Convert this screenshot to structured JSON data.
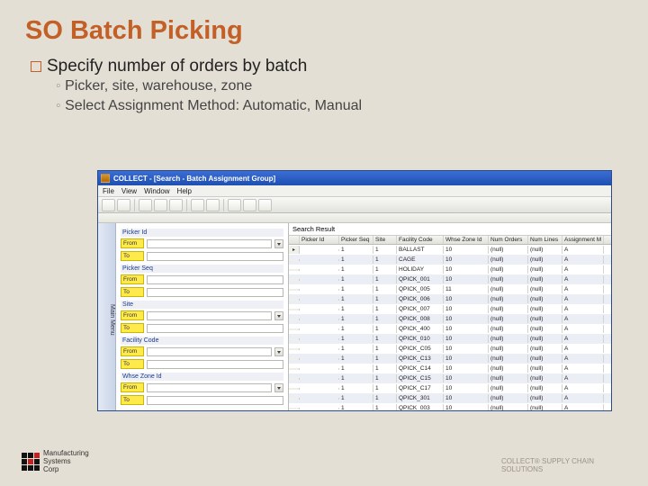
{
  "slide": {
    "title": "SO Batch Picking",
    "bullet": "Specify number of orders by batch",
    "subs": [
      "Picker, site, warehouse, zone",
      "Select Assignment Method: Automatic, Manual"
    ]
  },
  "footer": {
    "brand_line1": "Manufacturing",
    "brand_line2": "Systems",
    "brand_line3": "Corp",
    "tag_line1": "COLLECT® SUPPLY CHAIN",
    "tag_line2": "SOLUTIONS"
  },
  "app": {
    "titlebar": "COLLECT - [Search - Batch Assignment Group]",
    "menu": [
      "File",
      "View",
      "Window",
      "Help"
    ],
    "status": "",
    "sidebar_label": "Main Menu",
    "filters": {
      "groups": [
        {
          "header": "Picker Id",
          "rows": [
            {
              "label": "From",
              "dd": true
            },
            {
              "label": "To",
              "dd": false
            }
          ]
        },
        {
          "header": "Picker Seq",
          "rows": [
            {
              "label": "From",
              "dd": false
            },
            {
              "label": "To",
              "dd": false
            }
          ]
        },
        {
          "header": "Site",
          "rows": [
            {
              "label": "From",
              "dd": true
            },
            {
              "label": "To",
              "dd": false
            }
          ]
        },
        {
          "header": "Facility Code",
          "rows": [
            {
              "label": "From",
              "dd": true
            },
            {
              "label": "To",
              "dd": false
            }
          ]
        },
        {
          "header": "Whse Zone Id",
          "rows": [
            {
              "label": "From",
              "dd": true
            },
            {
              "label": "To",
              "dd": false
            }
          ]
        }
      ]
    },
    "results": {
      "title": "Search Result",
      "columns": [
        "Picker Id",
        "Picker Seq",
        "Site",
        "Facility Code",
        "Whse Zone Id",
        "Num Orders",
        "Num Lines",
        "Assignment M"
      ],
      "rows": [
        [
          "",
          "1",
          "1",
          "BALLAST",
          "10",
          "(null)",
          "(null)",
          "A"
        ],
        [
          "",
          "1",
          "1",
          "CAGE",
          "10",
          "(null)",
          "(null)",
          "A"
        ],
        [
          "",
          "1",
          "1",
          "HOLIDAY",
          "10",
          "(null)",
          "(null)",
          "A"
        ],
        [
          "",
          "1",
          "1",
          "QPICK_001",
          "10",
          "(null)",
          "(null)",
          "A"
        ],
        [
          "",
          "1",
          "1",
          "QPICK_005",
          "11",
          "(null)",
          "(null)",
          "A"
        ],
        [
          "",
          "1",
          "1",
          "QPICK_006",
          "10",
          "(null)",
          "(null)",
          "A"
        ],
        [
          "",
          "1",
          "1",
          "QPICK_007",
          "10",
          "(null)",
          "(null)",
          "A"
        ],
        [
          "",
          "1",
          "1",
          "QPICK_008",
          "10",
          "(null)",
          "(null)",
          "A"
        ],
        [
          "",
          "1",
          "1",
          "QPICK_400",
          "10",
          "(null)",
          "(null)",
          "A"
        ],
        [
          "",
          "1",
          "1",
          "QPICK_010",
          "10",
          "(null)",
          "(null)",
          "A"
        ],
        [
          "",
          "1",
          "1",
          "QPICK_C05",
          "10",
          "(null)",
          "(null)",
          "A"
        ],
        [
          "",
          "1",
          "1",
          "QPICK_C13",
          "10",
          "(null)",
          "(null)",
          "A"
        ],
        [
          "",
          "1",
          "1",
          "QPICK_C14",
          "10",
          "(null)",
          "(null)",
          "A"
        ],
        [
          "",
          "1",
          "1",
          "QPICK_C15",
          "10",
          "(null)",
          "(null)",
          "A"
        ],
        [
          "",
          "1",
          "1",
          "QPICK_C17",
          "10",
          "(null)",
          "(null)",
          "A"
        ],
        [
          "",
          "1",
          "1",
          "QPICK_301",
          "10",
          "(null)",
          "(null)",
          "A"
        ],
        [
          "",
          "1",
          "1",
          "QPICK_003",
          "10",
          "(null)",
          "(null)",
          "A"
        ]
      ]
    }
  }
}
